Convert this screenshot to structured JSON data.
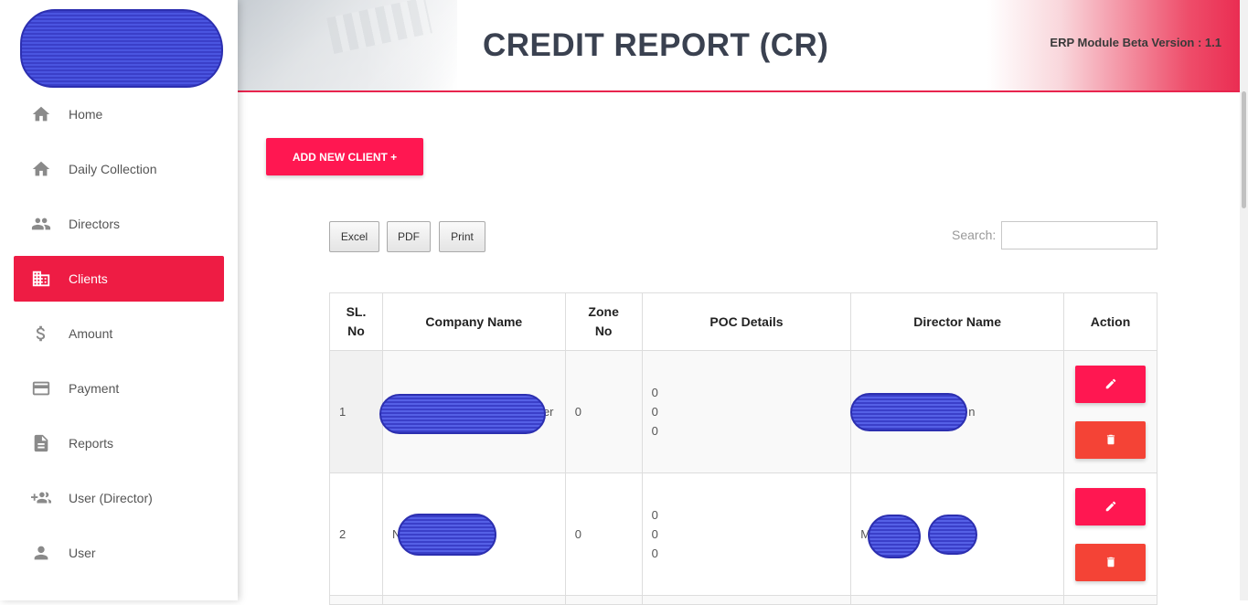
{
  "header": {
    "title": "CREDIT REPORT (CR)",
    "version": "ERP Module Beta Version : 1.1"
  },
  "sidebar": {
    "items": [
      {
        "label": "Home",
        "icon": "home-icon"
      },
      {
        "label": "Daily Collection",
        "icon": "home-icon"
      },
      {
        "label": "Directors",
        "icon": "people-icon"
      },
      {
        "label": "Clients",
        "icon": "building-icon",
        "active": true
      },
      {
        "label": "Amount",
        "icon": "dollar-icon"
      },
      {
        "label": "Payment",
        "icon": "credit-card-icon"
      },
      {
        "label": "Reports",
        "icon": "document-icon"
      },
      {
        "label": "User (Director)",
        "icon": "add-group-icon"
      },
      {
        "label": "User",
        "icon": "person-icon"
      }
    ]
  },
  "main": {
    "add_button": "ADD NEW CLIENT +",
    "export": {
      "excel": "Excel",
      "pdf": "PDF",
      "print": "Print"
    },
    "search_label": "Search:",
    "search_value": ""
  },
  "table": {
    "headers": [
      "SL.\nNo",
      "Company Name",
      "Zone\nNo",
      "POC Details",
      "Director Name",
      "Action"
    ],
    "header_lines": {
      "sl": [
        "SL.",
        "No"
      ],
      "company": "Company Name",
      "zone": [
        "Zone",
        "No"
      ],
      "poc": "POC Details",
      "director": "Director Name",
      "action": "Action"
    },
    "rows": [
      {
        "sl": "1",
        "company_visible": "er",
        "zone": "0",
        "poc": [
          "0",
          "0",
          "0"
        ],
        "director_visible": "n"
      },
      {
        "sl": "2",
        "company_visible": "N          ed",
        "zone": "0",
        "poc": [
          "0",
          "0",
          "0"
        ],
        "director_visible": "M          u"
      }
    ]
  },
  "colors": {
    "accent": "#ee1c44",
    "button": "#ff1751",
    "delete": "#f44336",
    "title": "#3a4150"
  }
}
